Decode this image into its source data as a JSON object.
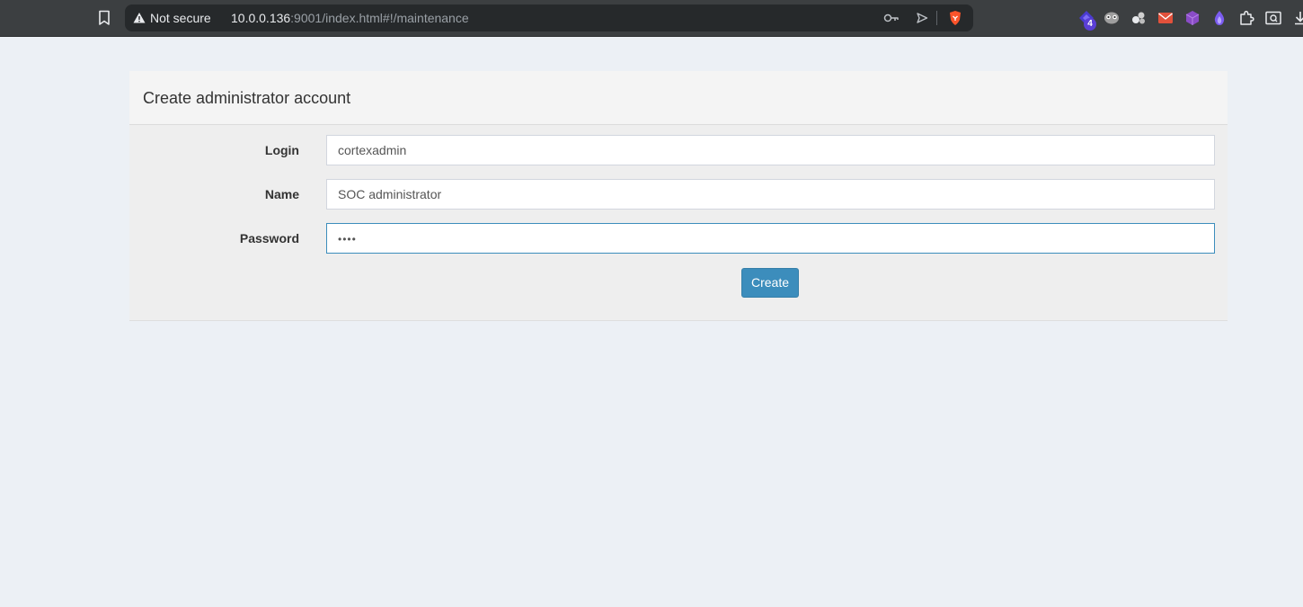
{
  "browser": {
    "security_label": "Not secure",
    "url_host": "10.0.0.136",
    "url_rest": ":9001/index.html#!/maintenance",
    "extension_badge": "4",
    "colors": {
      "toolbar_bg": "#3c3f41",
      "omnibox_bg": "#26292b",
      "brave_orange": "#fb542b"
    }
  },
  "form": {
    "title": "Create administrator account",
    "fields": [
      {
        "label": "Login",
        "value": "cortexadmin"
      },
      {
        "label": "Name",
        "value": "SOC administrator"
      },
      {
        "label": "Password",
        "value": "••••"
      }
    ],
    "submit_label": "Create",
    "colors": {
      "page_bg": "#ecf0f5",
      "primary": "#3c8dbc",
      "focus_border": "#3c8dbc"
    }
  }
}
